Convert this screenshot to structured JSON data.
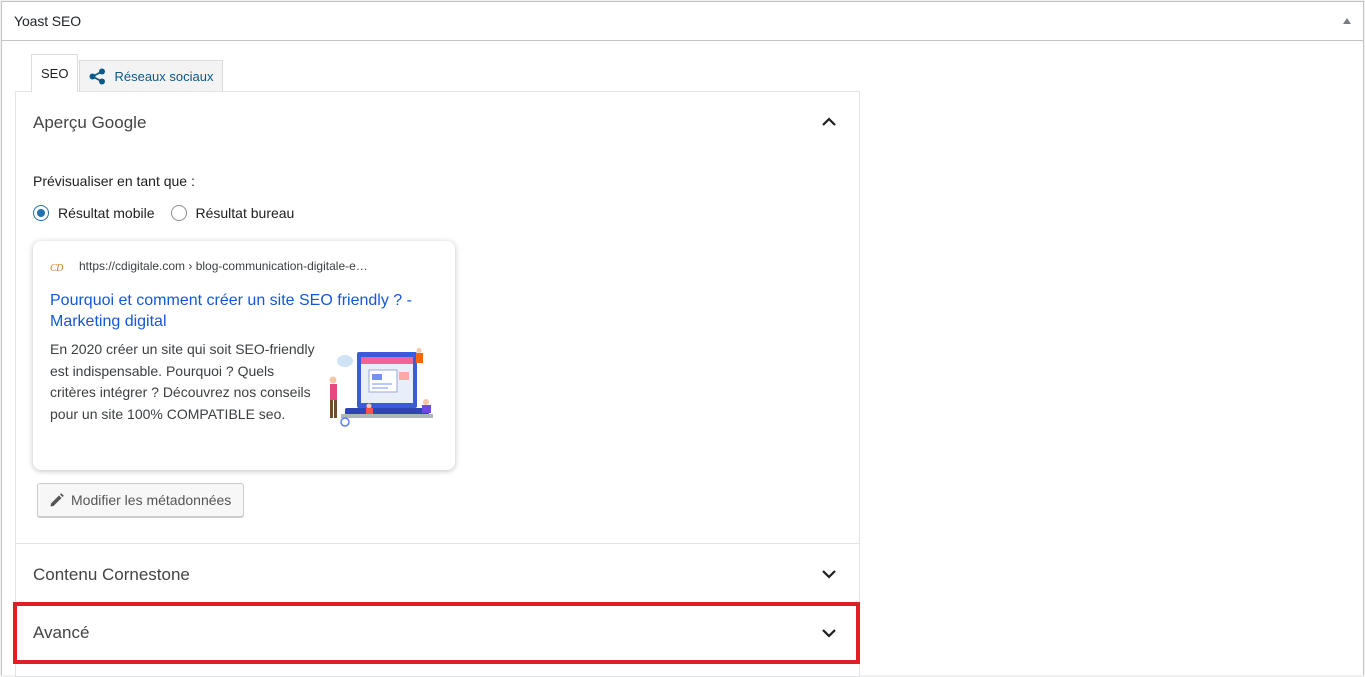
{
  "metabox": {
    "title": "Yoast SEO"
  },
  "tabs": [
    {
      "label": "SEO",
      "active": true
    },
    {
      "label": "Réseaux sociaux",
      "active": false,
      "icon": "share-icon"
    }
  ],
  "google_preview": {
    "title": "Aperçu Google",
    "preview_as_label": "Prévisualiser en tant que :",
    "radio_options": [
      {
        "label": "Résultat mobile",
        "checked": true
      },
      {
        "label": "Résultat bureau",
        "checked": false
      }
    ],
    "serp": {
      "favicon_text": "CD",
      "url": "https://cdigitale.com › blog-communication-digitale-e…",
      "title": "Pourquoi et comment créer un site SEO friendly ? - Marketing digital",
      "description": "En 2020 créer un site qui soit SEO-friendly est indispensable. Pourquoi ? Quels critères intégrer ? Découvrez nos conseils pour un site 100% COMPATIBLE seo."
    },
    "edit_button_label": "Modifier les métadonnées"
  },
  "cornerstone": {
    "title": "Contenu Cornestone"
  },
  "advanced": {
    "title": "Avancé"
  },
  "colors": {
    "link_blue": "#1558d6",
    "tab_link": "#0a5a8c",
    "highlight_red": "#e11e26",
    "radio_checked": "#2271b1"
  }
}
